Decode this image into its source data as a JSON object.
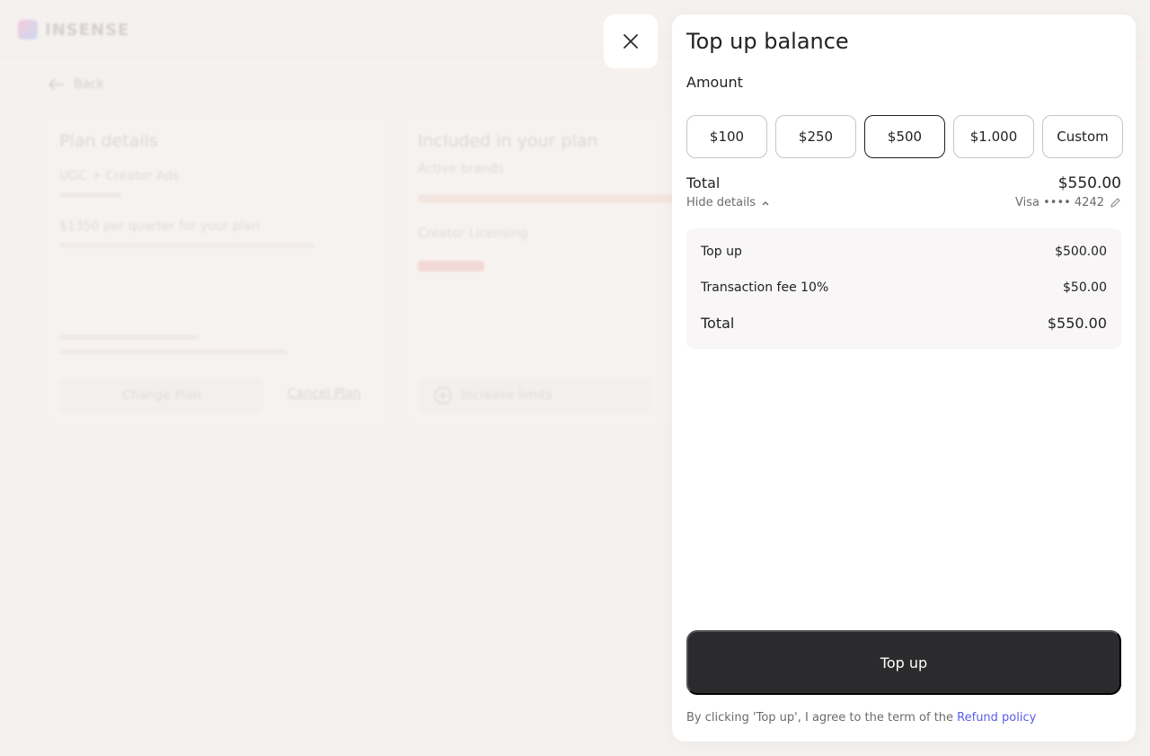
{
  "background": {
    "logo_text": "INSENSE",
    "back_label": "Back",
    "plan_card": {
      "title": "Plan details",
      "plan_name": "UGC + Creator Ads",
      "price_text": "$1350 per quarter for your plan",
      "change_plan": "Change Plan",
      "cancel_plan": "Cancel Plan"
    },
    "included_card": {
      "title": "Included in your plan",
      "active_brands": "Active brands",
      "creator_licensing": "Creator Licensing",
      "increase_limits": "Increase limits"
    }
  },
  "drawer": {
    "title": "Top up balance",
    "amount_label": "Amount",
    "amount_options": [
      "$100",
      "$250",
      "$500",
      "$1.000",
      "Custom"
    ],
    "selected_amount": "$500",
    "total_label": "Total",
    "total_value": "$550.00",
    "hide_details": "Hide details",
    "card_info": "Visa •••• 4242",
    "details": {
      "topup_label": "Top up",
      "topup_value": "$500.00",
      "fee_label": "Transaction fee 10%",
      "fee_value": "$50.00",
      "total_label": "Total",
      "total_value": "$550.00"
    },
    "topup_button": "Top up",
    "agree_text": "By clicking 'Top up', I agree to the term of the ",
    "refund_link": "Refund policy"
  }
}
